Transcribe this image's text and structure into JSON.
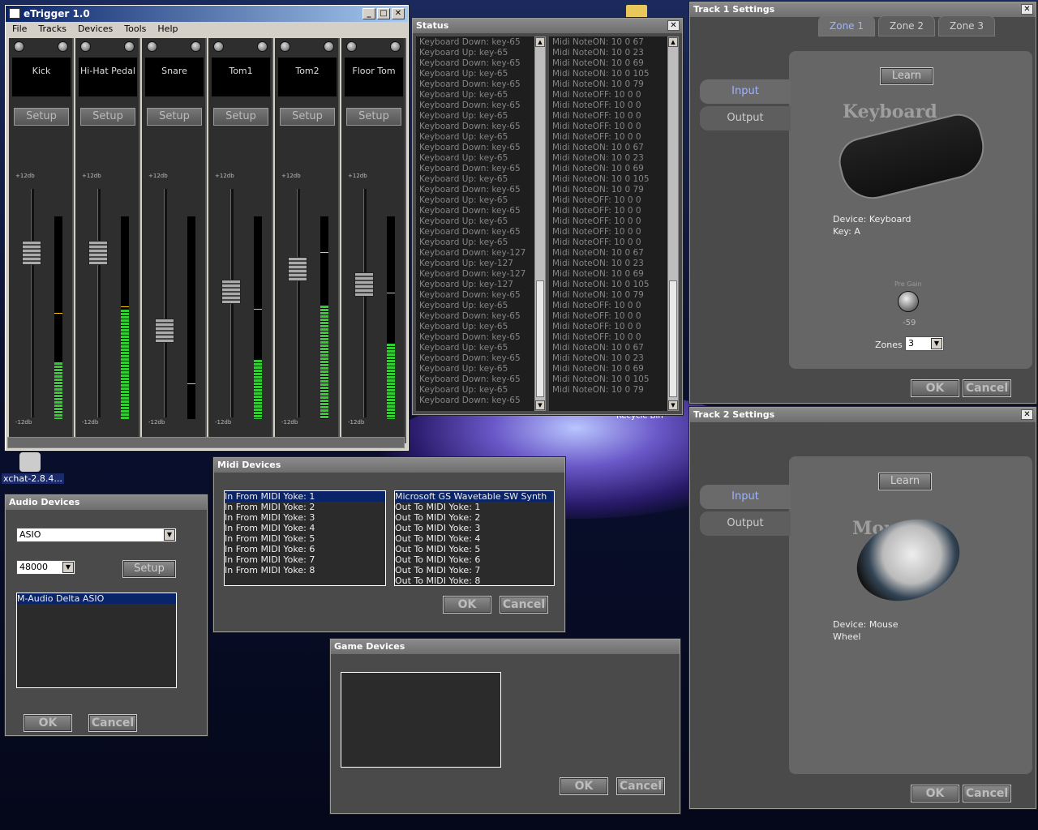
{
  "etrigger": {
    "title": "eTrigger 1.0",
    "menu": [
      "File",
      "Tracks",
      "Devices",
      "Tools",
      "Help"
    ],
    "channels": [
      {
        "name": "Kick",
        "setup": "Setup",
        "fader": 0.72,
        "level": 0.28,
        "peak": 0.52
      },
      {
        "name": "Hi-Hat Pedal",
        "setup": "Setup",
        "fader": 0.72,
        "level": 0.54,
        "peak": 0.55
      },
      {
        "name": "Snare",
        "setup": "Setup",
        "fader": 0.38,
        "level": 0.0,
        "peak": 0.17
      },
      {
        "name": "Tom1",
        "setup": "Setup",
        "fader": 0.55,
        "level": 0.29,
        "peak": 0.54
      },
      {
        "name": "Tom2",
        "setup": "Setup",
        "fader": 0.65,
        "level": 0.56,
        "peak": 0.82
      },
      {
        "name": "Floor Tom",
        "setup": "Setup",
        "fader": 0.58,
        "level": 0.37,
        "peak": 0.62
      }
    ],
    "db_top": "+12db",
    "db_bottom": "-12db"
  },
  "status": {
    "title": "Status",
    "left_log": [
      "Keyboard Down: key-65",
      "Keyboard Up: key-65",
      "Keyboard Down: key-65",
      "Keyboard Up: key-65",
      "Keyboard Down: key-65",
      "Keyboard Up: key-65",
      "Keyboard Down: key-65",
      "Keyboard Up: key-65",
      "Keyboard Down: key-65",
      "Keyboard Up: key-65",
      "Keyboard Down: key-65",
      "Keyboard Up: key-65",
      "Keyboard Down: key-65",
      "Keyboard Up: key-65",
      "Keyboard Down: key-65",
      "Keyboard Up: key-65",
      "Keyboard Down: key-65",
      "Keyboard Up: key-65",
      "Keyboard Down: key-65",
      "Keyboard Up: key-65",
      "Keyboard Down: key-127",
      "Keyboard Up: key-127",
      "Keyboard Down: key-127",
      "Keyboard Up: key-127",
      "Keyboard Down: key-65",
      "Keyboard Up: key-65",
      "Keyboard Down: key-65",
      "Keyboard Up: key-65",
      "Keyboard Down: key-65",
      "Keyboard Up: key-65",
      "Keyboard Down: key-65",
      "Keyboard Up: key-65",
      "Keyboard Down: key-65",
      "Keyboard Up: key-65",
      "Keyboard Down: key-65"
    ],
    "right_log": [
      "Midi NoteON:  10  0  67",
      "Midi NoteON:  10  0  23",
      "Midi NoteON:  10  0  69",
      "Midi NoteON:  10  0  105",
      "Midi NoteON:  10  0  79",
      "Midi NoteOFF:  10  0  0",
      "Midi NoteOFF:  10  0  0",
      "Midi NoteOFF:  10  0  0",
      "Midi NoteOFF:  10  0  0",
      "Midi NoteOFF:  10  0  0",
      "Midi NoteON:  10  0  67",
      "Midi NoteON:  10  0  23",
      "Midi NoteON:  10  0  69",
      "Midi NoteON:  10  0  105",
      "Midi NoteON:  10  0  79",
      "Midi NoteOFF:  10  0  0",
      "Midi NoteOFF:  10  0  0",
      "Midi NoteOFF:  10  0  0",
      "Midi NoteOFF:  10  0  0",
      "Midi NoteOFF:  10  0  0",
      "Midi NoteON:  10  0  67",
      "Midi NoteON:  10  0  23",
      "Midi NoteON:  10  0  69",
      "Midi NoteON:  10  0  105",
      "Midi NoteON:  10  0  79",
      "Midi NoteOFF:  10  0  0",
      "Midi NoteOFF:  10  0  0",
      "Midi NoteOFF:  10  0  0",
      "Midi NoteOFF:  10  0  0",
      "Midi NoteON:  10  0  67",
      "Midi NoteON:  10  0  23",
      "Midi NoteON:  10  0  69",
      "Midi NoteON:  10  0  105",
      "Midi NoteON:  10  0  79"
    ]
  },
  "track1": {
    "title": "Track 1 Settings",
    "zones": [
      "Zone 1",
      "Zone 2",
      "Zone 3"
    ],
    "input": "Input",
    "output": "Output",
    "learn": "Learn",
    "device_name": "Keyboard",
    "device_line": "Device: Keyboard",
    "key_line": "Key: A",
    "pregain_label": "Pre Gain",
    "pregain_value": "-59",
    "zones_label": "Zones",
    "zones_value": "3",
    "ok": "OK",
    "cancel": "Cancel"
  },
  "track2": {
    "title": "Track 2 Settings",
    "input": "Input",
    "output": "Output",
    "learn": "Learn",
    "device_name": "Mouse",
    "device_line": "Device: Mouse",
    "wheel_line": "Wheel",
    "ok": "OK",
    "cancel": "Cancel"
  },
  "midi": {
    "title": "Midi Devices",
    "inputs": [
      "In From MIDI Yoke:  1",
      "In From MIDI Yoke:  2",
      "In From MIDI Yoke:  3",
      "In From MIDI Yoke:  4",
      "In From MIDI Yoke:  5",
      "In From MIDI Yoke:  6",
      "In From MIDI Yoke:  7",
      "In From MIDI Yoke:  8"
    ],
    "outputs": [
      "Microsoft GS Wavetable SW Synth",
      "Out To MIDI Yoke:  1",
      "Out To MIDI Yoke:  2",
      "Out To MIDI Yoke:  3",
      "Out To MIDI Yoke:  4",
      "Out To MIDI Yoke:  5",
      "Out To MIDI Yoke:  6",
      "Out To MIDI Yoke:  7",
      "Out To MIDI Yoke:  8"
    ],
    "ok": "OK",
    "cancel": "Cancel"
  },
  "audio": {
    "title": "Audio Devices",
    "driver": "ASIO",
    "rate": "48000",
    "setup": "Setup",
    "devices": [
      "M-Audio Delta ASIO"
    ],
    "ok": "OK",
    "cancel": "Cancel"
  },
  "game": {
    "title": "Game Devices",
    "ok": "OK",
    "cancel": "Cancel"
  },
  "desktop": {
    "xchat": "xchat-2.8.4...",
    "recycle": "Recycle Bin"
  }
}
